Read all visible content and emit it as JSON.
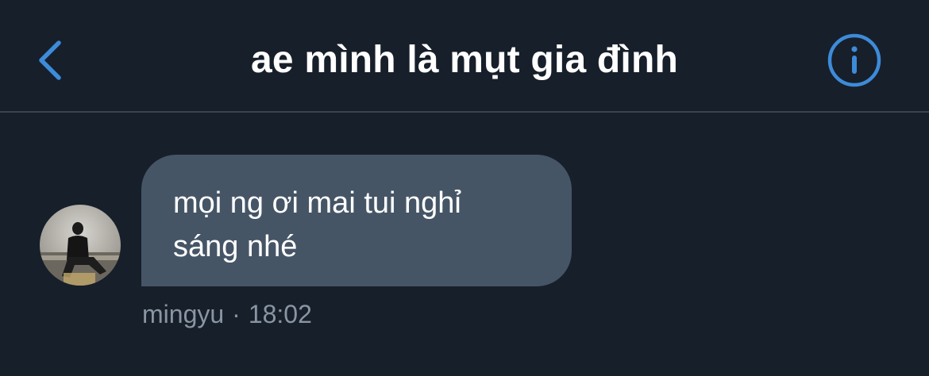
{
  "header": {
    "title": "ae mình là mụt gia đình",
    "back_icon": "chevron-left-icon",
    "info_icon": "info-circle-icon",
    "accent_color": "#3d8bd9"
  },
  "message": {
    "text_line_1": "mọi ng ơi mai tui nghỉ",
    "text_line_2": "sáng nhé",
    "sender": "mingyu",
    "separator": "·",
    "time": "18:02",
    "bubble_color": "#465566"
  },
  "colors": {
    "background": "#171f2a",
    "meta_text": "#8a95a3"
  }
}
